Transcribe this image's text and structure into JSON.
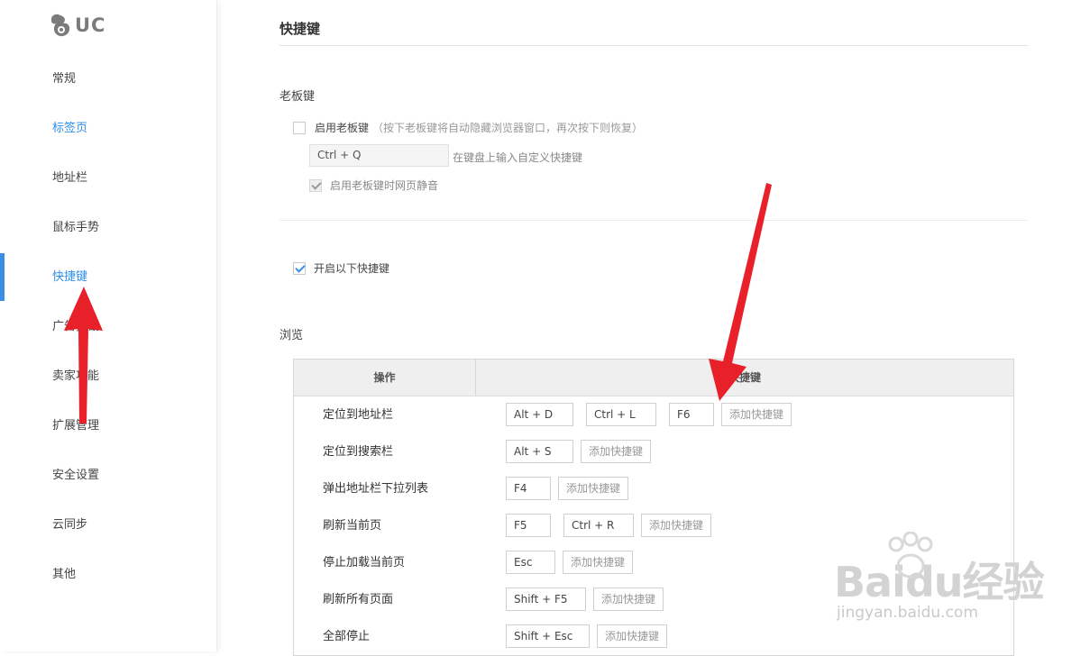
{
  "app": {
    "logo_text": "UC"
  },
  "sidebar": {
    "items": [
      {
        "label": "常规"
      },
      {
        "label": "标签页"
      },
      {
        "label": "地址栏"
      },
      {
        "label": "鼠标手势"
      },
      {
        "label": "快捷键"
      },
      {
        "label": "广告拦截"
      },
      {
        "label": "卖家功能"
      },
      {
        "label": "扩展管理"
      },
      {
        "label": "安全设置"
      },
      {
        "label": "云同步"
      },
      {
        "label": "其他"
      }
    ],
    "active_index": 4
  },
  "page": {
    "title": "快捷键",
    "boss_key": {
      "section_label": "老板键",
      "enable_label": "启用老板键",
      "enable_hint": "（按下老板键将自动隐藏浏览器窗口，再次按下则恢复）",
      "enable_checked": false,
      "key_value": "Ctrl + Q",
      "key_hint": "在键盘上输入自定义快捷键",
      "mute_label": "启用老板键时网页静音",
      "mute_checked": true
    },
    "shortcuts_enable": {
      "label": "开启以下快捷键",
      "checked": true
    },
    "browse": {
      "section_label": "浏览",
      "header_op": "操作",
      "header_keys": "快捷键",
      "add_label": "添加快捷键",
      "rows": [
        {
          "op": "定位到地址栏",
          "keys": [
            "Alt + D",
            "Ctrl + L",
            "F6"
          ]
        },
        {
          "op": "定位到搜索栏",
          "keys": [
            "Alt + S"
          ]
        },
        {
          "op": "弹出地址栏下拉列表",
          "keys": [
            "F4"
          ]
        },
        {
          "op": "刷新当前页",
          "keys": [
            "F5",
            "Ctrl + R"
          ]
        },
        {
          "op": "停止加载当前页",
          "keys": [
            "Esc"
          ]
        },
        {
          "op": "刷新所有页面",
          "keys": [
            "Shift + F5"
          ]
        },
        {
          "op": "全部停止",
          "keys": [
            "Shift + Esc"
          ]
        }
      ]
    }
  },
  "watermark": {
    "logo": "Baidu经验",
    "url": "jingyan.baidu.com"
  },
  "colors": {
    "accent": "#3a8ee6",
    "annotation_arrow": "#e8202a"
  }
}
